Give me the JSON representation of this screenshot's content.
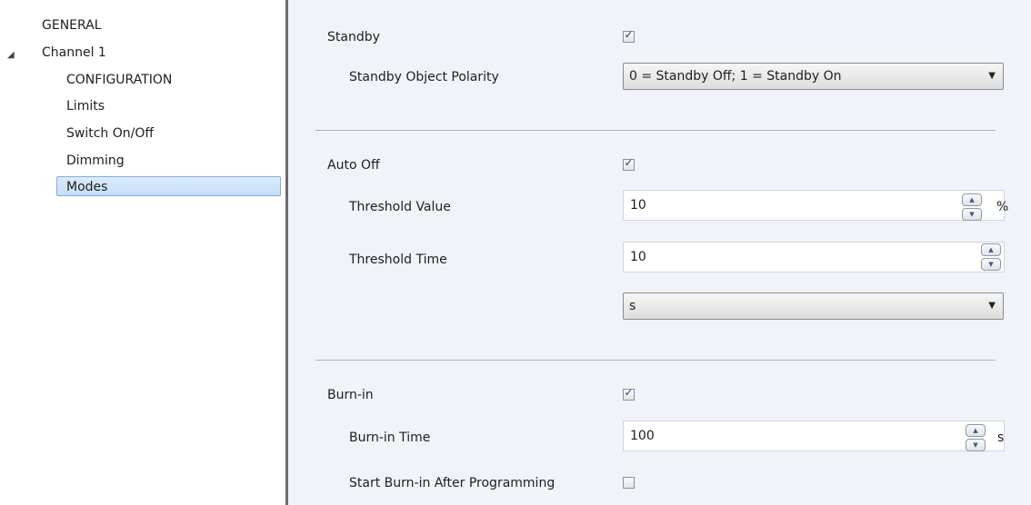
{
  "sidebar": {
    "items": [
      {
        "label": "GENERAL"
      },
      {
        "label": "Channel 1"
      },
      {
        "label": "CONFIGURATION"
      },
      {
        "label": "Limits"
      },
      {
        "label": "Switch On/Off"
      },
      {
        "label": "Dimming"
      },
      {
        "label": "Modes"
      }
    ],
    "selected": "Modes"
  },
  "standby": {
    "label": "Standby",
    "checked": true,
    "polarity_label": "Standby Object Polarity",
    "polarity_value": "0 = Standby Off; 1 = Standby On"
  },
  "auto_off": {
    "label": "Auto Off",
    "checked": true,
    "threshold_value_label": "Threshold Value",
    "threshold_value": "10",
    "threshold_value_unit": "%",
    "threshold_time_label": "Threshold Time",
    "threshold_time": "10",
    "threshold_time_unit_value": "s"
  },
  "burn_in": {
    "label": "Burn-in",
    "checked": true,
    "time_label": "Burn-in Time",
    "time_value": "100",
    "time_unit": "s",
    "after_programming_label": "Start Burn-in After Programming",
    "after_programming_checked": false
  },
  "icons": {
    "check": "✓",
    "caret": "▼",
    "spin_up": "▲",
    "spin_down": "▼",
    "tree_expanded": "◢"
  }
}
